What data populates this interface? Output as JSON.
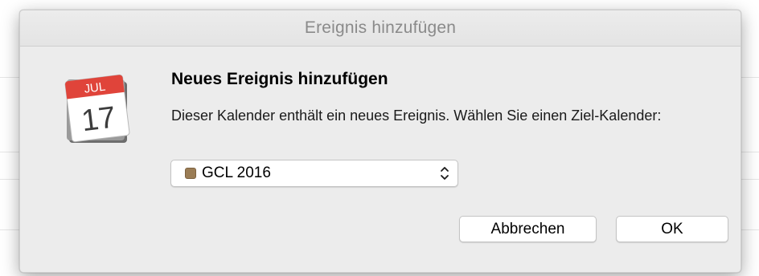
{
  "window": {
    "title": "Ereignis hinzufügen"
  },
  "dialog": {
    "headline": "Neues Ereignis hinzufügen",
    "message": "Dieser Kalender enthält ein neues Ereignis. Wählen Sie einen Ziel-Kalender:",
    "icon": {
      "name": "calendar-icon",
      "month": "JUL",
      "day": "17"
    }
  },
  "calendar_select": {
    "selected": "GCL 2016",
    "swatch_color": "#9a7c55"
  },
  "buttons": {
    "cancel_label": "Abbrechen",
    "ok_label": "OK"
  },
  "colors": {
    "dialog_bg": "#ececec",
    "title_text": "#8a8a8a",
    "calendar_red": "#e0443a"
  }
}
